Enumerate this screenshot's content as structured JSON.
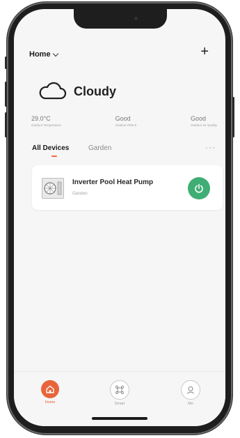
{
  "header": {
    "home_label": "Home",
    "add_icon": "plus-icon",
    "dropdown_icon": "chevron-down-icon"
  },
  "weather": {
    "condition": "Cloudy",
    "icon": "cloud-icon"
  },
  "stats": [
    {
      "value": "29.0°C",
      "label": "Outdoor Temperature"
    },
    {
      "value": "Good",
      "label": "Outdoor PM2.5"
    },
    {
      "value": "Good",
      "label": "Outdoor Air Quality"
    }
  ],
  "tabs": {
    "items": [
      "All Devices",
      "Garden"
    ],
    "active": "All Devices",
    "more_label": "···"
  },
  "device": {
    "name": "Inverter Pool Heat Pump",
    "room": "Garden",
    "power_icon": "power-icon",
    "power_color": "#3fae74"
  },
  "nav": {
    "items": [
      {
        "label": "Home",
        "icon": "home-icon",
        "active": true
      },
      {
        "label": "Smart",
        "icon": "smart-icon",
        "active": false
      },
      {
        "label": "Me",
        "icon": "me-icon",
        "active": false
      }
    ],
    "active_color": "#e8643a"
  }
}
